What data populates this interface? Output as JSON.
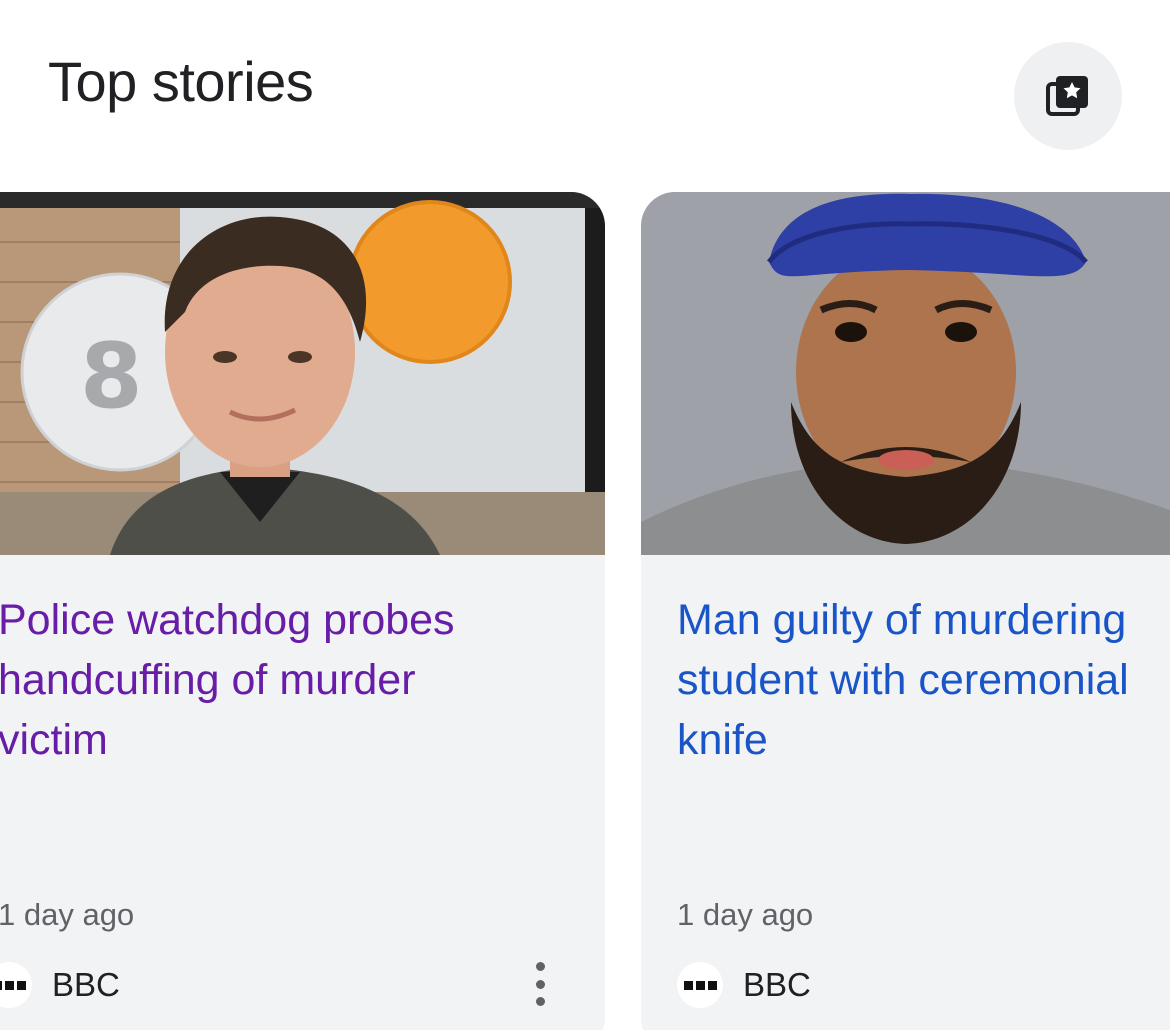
{
  "header": {
    "title": "Top stories",
    "saved_icon": "saved-collections-star-icon"
  },
  "stories": [
    {
      "headline": "Police watchdog probes\nhandcuffing of murder\nvictim",
      "age": "1 day ago",
      "source": "BBC",
      "source_logo_icon": "bbc-logo-icon",
      "thumbnail_icon": "portrait-photo-young-man",
      "headline_color": "#681da8",
      "visited": true
    },
    {
      "headline": "Man guilty of murdering\nstudent with ceremonial\nknife",
      "age": "1 day ago",
      "source": "BBC",
      "source_logo_icon": "bbc-logo-icon",
      "thumbnail_icon": "portrait-photo-man-blue-turban",
      "headline_color": "#1a55c7",
      "visited": false
    }
  ],
  "card_menu_icon": "more-vertical-icon",
  "colors": {
    "visited_link": "#681da8",
    "link": "#1a55c7",
    "card_background": "#f2f3f5",
    "meta_text": "#5f6368"
  }
}
